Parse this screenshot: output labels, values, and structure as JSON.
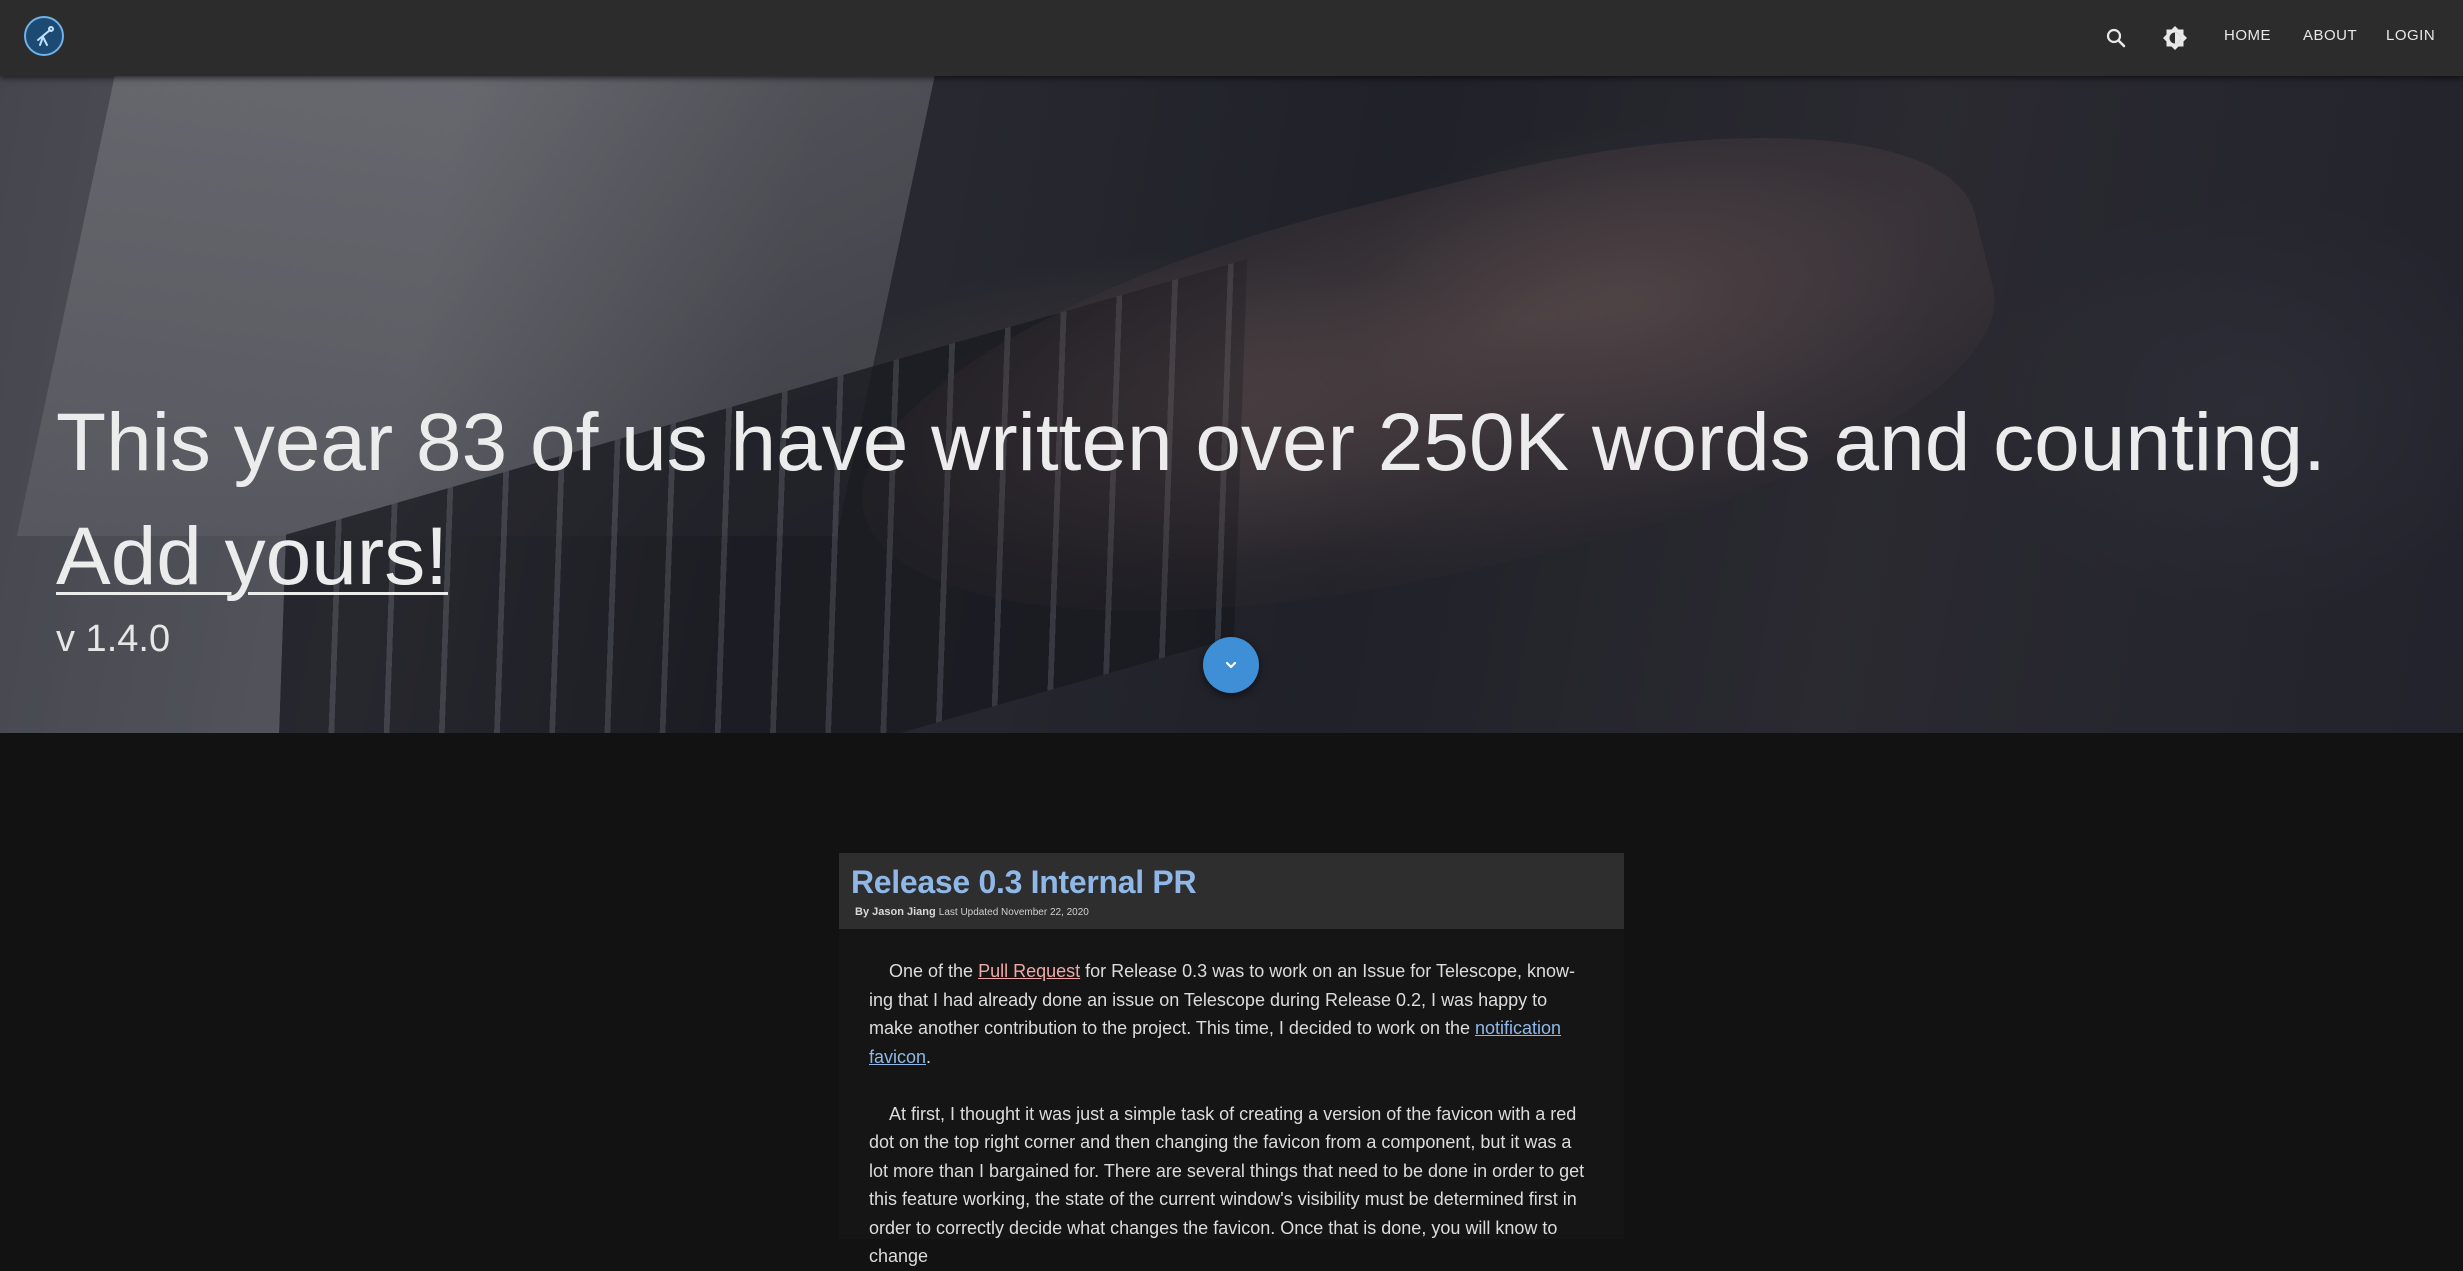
{
  "nav": {
    "logo_icon": "telescope-icon",
    "search_icon": "search-icon",
    "theme_icon": "brightness-icon",
    "links": [
      "HOME",
      "ABOUT",
      "LOGIN"
    ]
  },
  "hero": {
    "headline": "This year 83 of us have written over 250K words and counting.",
    "cta": "Add yours!",
    "version": "v 1.4.0",
    "scroll_icon": "chevron-down-icon"
  },
  "post": {
    "title": "Release 0.3 Internal PR",
    "author": "By Jason Jiang",
    "updated": "Last Updated November 22, 2020",
    "p1_a": "One of the ",
    "p1_link": "Pull Request",
    "p1_b": " for Release 0.3 was to work on an Issue for Telescope, know-ing that I had already done an issue on Telescope during Release 0.2, I was happy to make another contribution to the project. This time, I decided to work on the ",
    "p1_link2": "notification favicon",
    "p1_c": ".",
    "p2": "At first, I thought it was just a simple task of creating a version of the favicon with a red dot on the top right corner and then changing the favicon from a component, but it was a lot more than I bargained for. There are several things that need to be done in order to get this feature working, the state of the current window's visibility must be determined first in order to correctly decide what changes the favicon. Once that is done, you will know to change"
  },
  "colors": {
    "topbar": "#2c2c2c",
    "accent_blue": "#3f8fd6",
    "title_blue": "#8fb8e8",
    "link_pink": "#f0a8a8",
    "background": "#121212"
  }
}
